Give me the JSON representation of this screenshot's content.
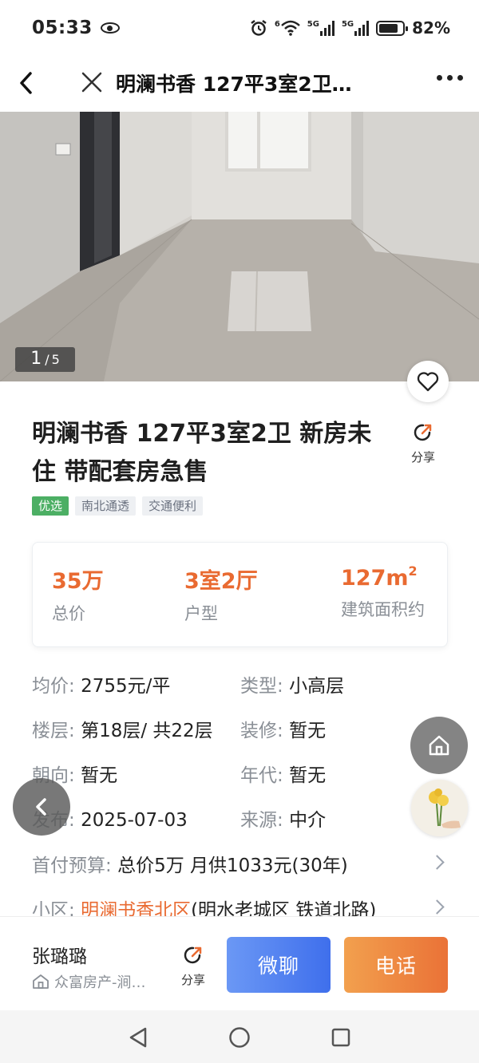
{
  "status_bar": {
    "time": "05:33",
    "battery_percent": "82%",
    "network_label_1": "5G",
    "network_label_2": "5G",
    "wifi_label": "6"
  },
  "nav": {
    "title": "明澜书香 127平3室2卫…"
  },
  "gallery": {
    "current": "1",
    "separator": "/",
    "total": "5"
  },
  "listing": {
    "title": "明澜书香 127平3室2卫 新房未住 带配套房急售",
    "share_label": "分享",
    "tags": [
      {
        "label": "优选"
      },
      {
        "label": "南北通透"
      },
      {
        "label": "交通便利"
      }
    ]
  },
  "summary": {
    "price": {
      "value": "35万",
      "label": "总价"
    },
    "layout": {
      "value": "3室2厅",
      "label": "户型"
    },
    "area": {
      "value": "127m",
      "unit_sup": "2",
      "label": "建筑面积约"
    }
  },
  "details": {
    "unit_price": {
      "key": "均价:",
      "value": "2755元/平"
    },
    "type": {
      "key": "类型:",
      "value": "小高层"
    },
    "floor": {
      "key": "楼层:",
      "value": "第18层/ 共22层"
    },
    "decoration": {
      "key": "装修:",
      "value": "暂无"
    },
    "orientation": {
      "key": "朝向:",
      "value": "暂无"
    },
    "era": {
      "key": "年代:",
      "value": "暂无"
    },
    "published": {
      "key": "发布:",
      "value": "2025-07-03"
    },
    "source": {
      "key": "来源:",
      "value": "中介"
    },
    "down_payment": {
      "key": "首付预算:",
      "value": "总价5万 月供1033元(30年)"
    },
    "community": {
      "key": "小区:",
      "link": "明澜书香北区",
      "value": "(明水老城区 铁道北路)"
    }
  },
  "agent": {
    "name": "张璐璐",
    "company": "众富房产-涧…",
    "share_label": "分享",
    "chat_label": "微聊",
    "call_label": "电话"
  },
  "colors": {
    "accent_orange": "#e96a31",
    "tag_green": "#4caf64",
    "chat_blue": "#3f6fec",
    "call_orange": "#ea7237"
  },
  "icons": [
    "back-arrow-icon",
    "close-icon",
    "more-icon",
    "heart-icon",
    "share-icon",
    "home-icon",
    "chevron-left-icon",
    "chevron-right-icon",
    "store-icon",
    "nav-back-triangle-icon",
    "nav-home-circle-icon",
    "nav-recents-square-icon"
  ]
}
